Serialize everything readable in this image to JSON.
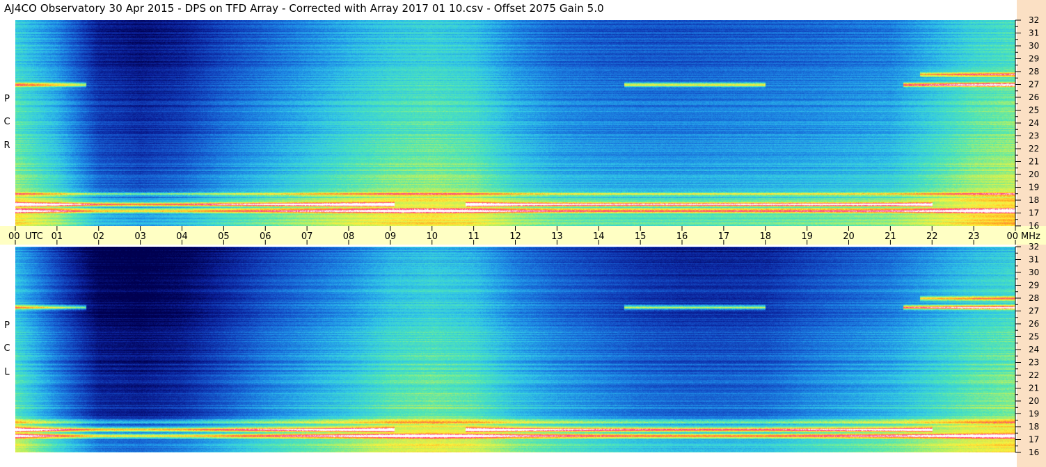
{
  "title": "AJ4CO Observatory  30 Apr 2015  -  DPS on TFD Array  -  Corrected with Array 2017 01 10.csv  -  Offset 2075  Gain 5.0",
  "panels": [
    {
      "id": "rcp",
      "letters": [
        "P",
        "C",
        "R"
      ]
    },
    {
      "id": "lcp",
      "letters": [
        "P",
        "C",
        "L"
      ]
    }
  ],
  "colors": {
    "right_strip": "#fbe0c4",
    "utc_band": "#ffffc4",
    "colormap": [
      "#000050",
      "#0a1e96",
      "#1450c8",
      "#1e8ce6",
      "#32c8e6",
      "#50e6b4",
      "#b4f064",
      "#fff03c",
      "#ffa01e",
      "#ff3c8c",
      "#ffffff"
    ]
  },
  "chart_data": [
    {
      "type": "heatmap",
      "panel": "RCP",
      "x_unit": "UTC",
      "x_start": "00",
      "x_end": "00",
      "x_tick_labels": [
        "00",
        "01",
        "02",
        "03",
        "04",
        "05",
        "06",
        "07",
        "08",
        "09",
        "10",
        "11",
        "12",
        "13",
        "14",
        "15",
        "16",
        "17",
        "18",
        "19",
        "20",
        "21",
        "22",
        "23",
        "00"
      ],
      "y_unit": "MHz",
      "y_range": [
        16,
        32
      ],
      "y_tick_labels": [
        "32",
        "31",
        "30",
        "29",
        "28",
        "27",
        "26",
        "25",
        "24",
        "23",
        "22",
        "21",
        "20",
        "19",
        "18",
        "17",
        "16"
      ],
      "colormap_order": "low to high intensity: dark blue, blue, cyan, green, yellow, orange, magenta, white",
      "background_level_utc": [
        {
          "utc": 0,
          "level": 0.55
        },
        {
          "utc": 1,
          "level": 0.42
        },
        {
          "utc": 2,
          "level": 0.22
        },
        {
          "utc": 3,
          "level": 0.18
        },
        {
          "utc": 4,
          "level": 0.22
        },
        {
          "utc": 5,
          "level": 0.3
        },
        {
          "utc": 6,
          "level": 0.36
        },
        {
          "utc": 7,
          "level": 0.42
        },
        {
          "utc": 8,
          "level": 0.48
        },
        {
          "utc": 9,
          "level": 0.53
        },
        {
          "utc": 10,
          "level": 0.55
        },
        {
          "utc": 11,
          "level": 0.52
        },
        {
          "utc": 12,
          "level": 0.42
        },
        {
          "utc": 13,
          "level": 0.36
        },
        {
          "utc": 14,
          "level": 0.34
        },
        {
          "utc": 15,
          "level": 0.33
        },
        {
          "utc": 16,
          "level": 0.33
        },
        {
          "utc": 17,
          "level": 0.34
        },
        {
          "utc": 18,
          "level": 0.35
        },
        {
          "utc": 19,
          "level": 0.36
        },
        {
          "utc": 20,
          "level": 0.38
        },
        {
          "utc": 21,
          "level": 0.4
        },
        {
          "utc": 22,
          "level": 0.48
        },
        {
          "utc": 23,
          "level": 0.56
        },
        {
          "utc": 24,
          "level": 0.6
        }
      ],
      "interference_bands": [
        {
          "mhz": 27.0,
          "utc_start": 0.0,
          "utc_end": 1.7,
          "intensity": "high"
        },
        {
          "mhz": 27.0,
          "utc_start": 14.6,
          "utc_end": 18.0,
          "intensity": "high"
        },
        {
          "mhz": 27.0,
          "utc_start": 21.3,
          "utc_end": 24.0,
          "intensity": "very high"
        },
        {
          "mhz": 27.8,
          "utc_start": 21.7,
          "utc_end": 24.0,
          "intensity": "high"
        },
        {
          "mhz": 17.7,
          "utc_start": 0.0,
          "utc_end": 9.1,
          "intensity": "very high"
        },
        {
          "mhz": 17.7,
          "utc_start": 10.8,
          "utc_end": 22.0,
          "intensity": "very high"
        },
        {
          "mhz": 17.2,
          "utc_start": 0.0,
          "utc_end": 24.0,
          "intensity": "high"
        },
        {
          "mhz": 18.5,
          "utc_start": 0.0,
          "utc_end": 24.0,
          "intensity": "medium"
        }
      ]
    },
    {
      "type": "heatmap",
      "panel": "LCP",
      "x_unit": "UTC",
      "x_tick_labels": [
        "00",
        "01",
        "02",
        "03",
        "04",
        "05",
        "06",
        "07",
        "08",
        "09",
        "10",
        "11",
        "12",
        "13",
        "14",
        "15",
        "16",
        "17",
        "18",
        "19",
        "20",
        "21",
        "22",
        "23",
        "00"
      ],
      "y_unit": "MHz",
      "y_range": [
        16,
        32
      ],
      "y_tick_labels": [
        "32",
        "31",
        "30",
        "29",
        "28",
        "27",
        "26",
        "25",
        "24",
        "23",
        "22",
        "21",
        "20",
        "19",
        "18",
        "17",
        "16"
      ],
      "background_level_utc": [
        {
          "utc": 0,
          "level": 0.5
        },
        {
          "utc": 1,
          "level": 0.3
        },
        {
          "utc": 2,
          "level": 0.12
        },
        {
          "utc": 3,
          "level": 0.1
        },
        {
          "utc": 4,
          "level": 0.14
        },
        {
          "utc": 5,
          "level": 0.22
        },
        {
          "utc": 6,
          "level": 0.3
        },
        {
          "utc": 7,
          "level": 0.36
        },
        {
          "utc": 8,
          "level": 0.42
        },
        {
          "utc": 9,
          "level": 0.5
        },
        {
          "utc": 10,
          "level": 0.53
        },
        {
          "utc": 11,
          "level": 0.5
        },
        {
          "utc": 12,
          "level": 0.4
        },
        {
          "utc": 13,
          "level": 0.34
        },
        {
          "utc": 14,
          "level": 0.3
        },
        {
          "utc": 15,
          "level": 0.26
        },
        {
          "utc": 16,
          "level": 0.24
        },
        {
          "utc": 17,
          "level": 0.24
        },
        {
          "utc": 18,
          "level": 0.25
        },
        {
          "utc": 19,
          "level": 0.3
        },
        {
          "utc": 20,
          "level": 0.34
        },
        {
          "utc": 21,
          "level": 0.38
        },
        {
          "utc": 22,
          "level": 0.45
        },
        {
          "utc": 23,
          "level": 0.52
        },
        {
          "utc": 24,
          "level": 0.56
        }
      ],
      "interference_bands": [
        {
          "mhz": 27.3,
          "utc_start": 0.0,
          "utc_end": 1.7,
          "intensity": "high"
        },
        {
          "mhz": 27.3,
          "utc_start": 14.6,
          "utc_end": 18.0,
          "intensity": "high"
        },
        {
          "mhz": 27.3,
          "utc_start": 21.3,
          "utc_end": 24.0,
          "intensity": "very high"
        },
        {
          "mhz": 28.0,
          "utc_start": 21.7,
          "utc_end": 24.0,
          "intensity": "high"
        },
        {
          "mhz": 17.8,
          "utc_start": 0.0,
          "utc_end": 9.1,
          "intensity": "very high"
        },
        {
          "mhz": 17.8,
          "utc_start": 10.8,
          "utc_end": 22.0,
          "intensity": "very high"
        },
        {
          "mhz": 17.3,
          "utc_start": 0.0,
          "utc_end": 24.0,
          "intensity": "high"
        },
        {
          "mhz": 18.4,
          "utc_start": 0.0,
          "utc_end": 24.0,
          "intensity": "medium"
        }
      ]
    }
  ],
  "axis": {
    "utc_label": "UTC",
    "mhz_label": "MHz"
  }
}
